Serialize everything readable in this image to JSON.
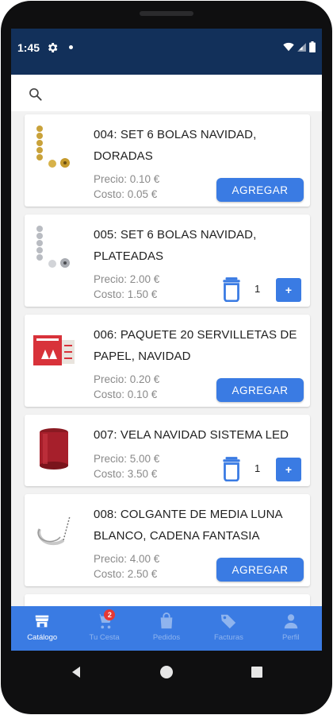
{
  "status_bar": {
    "time": "1:45",
    "icons": [
      "gear-icon",
      "dot-icon",
      "wifi-icon",
      "signal-icon",
      "battery-icon"
    ]
  },
  "colors": {
    "status_bar_bg": "#12305a",
    "accent": "#3a7be3",
    "badge": "#e53935"
  },
  "search": {
    "icon": "search-icon"
  },
  "products": [
    {
      "title": "004: SET 6 BOLAS NAVIDAD, DORADAS",
      "price": "Precio: 0.10 €",
      "cost": "Costo: 0.05 €",
      "action": "AGREGAR",
      "in_cart": false
    },
    {
      "title": "005: SET 6 BOLAS NAVIDAD, PLATEADAS",
      "price": "Precio: 2.00 €",
      "cost": "Costo: 1.50 €",
      "in_cart": true,
      "quantity": "1",
      "plus": "+"
    },
    {
      "title": "006: PAQUETE 20 SERVILLETAS DE PAPEL, NAVIDAD",
      "price": "Precio: 0.20 €",
      "cost": "Costo: 0.10 €",
      "action": "AGREGAR",
      "in_cart": false
    },
    {
      "title": "007: VELA NAVIDAD SISTEMA LED",
      "price": "Precio: 5.00 €",
      "cost": "Costo: 3.50 €",
      "in_cart": true,
      "quantity": "1",
      "plus": "+"
    },
    {
      "title": "008: COLGANTE DE MEDIA LUNA BLANCO, CADENA FANTASIA",
      "price": "Precio: 4.00 €",
      "cost": "Costo: 2.50 €",
      "action": "AGREGAR",
      "in_cart": false
    }
  ],
  "bottom_nav": {
    "items": [
      {
        "label": "Catálogo",
        "icon": "store-icon",
        "active": true
      },
      {
        "label": "Tu Cesta",
        "icon": "cart-icon",
        "badge": "2"
      },
      {
        "label": "Pedidos",
        "icon": "bag-icon"
      },
      {
        "label": "Facturas",
        "icon": "tag-icon"
      },
      {
        "label": "Perfil",
        "icon": "person-icon"
      }
    ]
  },
  "system_nav": [
    "back-icon",
    "home-icon",
    "recents-icon"
  ]
}
